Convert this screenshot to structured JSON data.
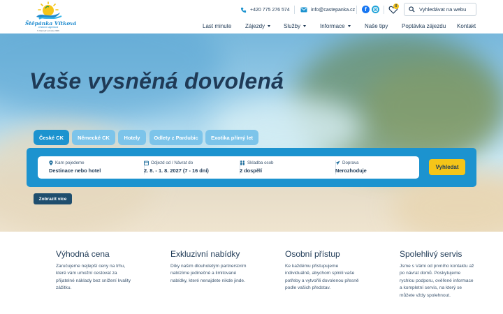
{
  "logo": {
    "name": "Štěpánka Vítková",
    "subtitle": "cestovní agentura",
    "since": "S Vámi již od roku 2006"
  },
  "header": {
    "phone": "+420 775 276 574",
    "email": "info@castepanka.cz",
    "favorites_count": "0",
    "search_placeholder": "Vyhledávat na webu"
  },
  "nav": {
    "items": [
      {
        "label": "Last minute",
        "dropdown": false
      },
      {
        "label": "Zájezdy",
        "dropdown": true
      },
      {
        "label": "Služby",
        "dropdown": true
      },
      {
        "label": "Informace",
        "dropdown": true
      },
      {
        "label": "Naše tipy",
        "dropdown": false
      },
      {
        "label": "Poptávka zájezdu",
        "dropdown": false
      },
      {
        "label": "Kontakt",
        "dropdown": false
      }
    ]
  },
  "hero": {
    "headline": "Vaše vysněná dovolená",
    "tabs": [
      {
        "label": "České CK",
        "active": true
      },
      {
        "label": "Německé CK",
        "active": false
      },
      {
        "label": "Hotely",
        "active": false
      },
      {
        "label": "Odlety z Pardubic",
        "active": false
      },
      {
        "label": "Exotika přímý let",
        "active": false
      }
    ],
    "fields": [
      {
        "label": "Kam pojedeme",
        "value": "Destinace nebo hotel",
        "icon": "map-pin-icon"
      },
      {
        "label": "Odjezd od / Návrat do",
        "value": "2. 8. - 1. 8. 2027 (7 - 16 dní)",
        "icon": "calendar-icon"
      },
      {
        "label": "Skladba osob",
        "value": "2 dospělí",
        "icon": "people-icon"
      },
      {
        "label": "Doprava",
        "value": "Nerozhoduje",
        "icon": "plane-icon"
      }
    ],
    "search_button": "Vyhledat",
    "more_button": "Zobrazit více"
  },
  "features": [
    {
      "title": "Výhodná cena",
      "text": "Zaručujeme nejlepší ceny na trhu, které vám umožní cestovat za přijatelné náklady bez snížení kvality zážitku."
    },
    {
      "title": "Exkluzivní nabídky",
      "text": "Díky našim dlouholetým partnerstvím nabízíme jedinečné a limitované nabídky, které nenajdete nikde jinde."
    },
    {
      "title": "Osobní přístup",
      "text": "Ke každému přistupujeme individuálně, abychom splnili vaše potřeby a vytvořili dovolenou přesně podle vašich představ."
    },
    {
      "title": "Spolehlivý servis",
      "text": "Jsme s Vámi od prvního kontaktu až po návrat domů. Poskytujeme rychlou podporu, ověřené informace a kompletní servis, na který se můžete vždy spolehnout."
    }
  ],
  "colors": {
    "primary_blue": "#1c93cf",
    "light_tab": "#7cc4ea",
    "dark_navy": "#1f3a56",
    "accent_yellow": "#f5c518",
    "more_button": "#1f4e6e"
  }
}
